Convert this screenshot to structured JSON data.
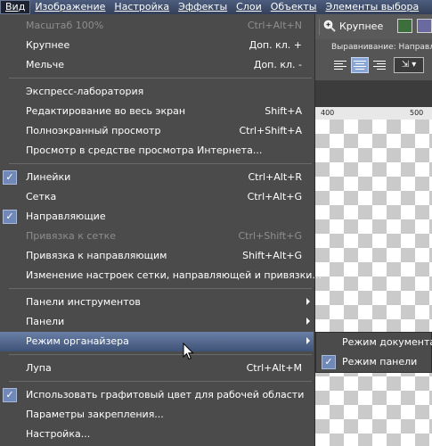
{
  "menubar": {
    "items": [
      {
        "label": "Вид"
      },
      {
        "label": "Изображение"
      },
      {
        "label": "Настройка"
      },
      {
        "label": "Эффекты"
      },
      {
        "label": "Слои"
      },
      {
        "label": "Объекты"
      },
      {
        "label": "Элементы выбора"
      }
    ]
  },
  "toolbar": {
    "zoom_in_label": "Крупнее",
    "zoom_icon": "magnifier-plus-icon",
    "alignment_label": "Выравнивание:  Направле"
  },
  "ruler": {
    "tick1": "400",
    "tick2": "500"
  },
  "view_menu": {
    "items": [
      {
        "label": "Масштаб 100%",
        "shortcut": "Ctrl+Alt+N",
        "disabled": true
      },
      {
        "label": "Крупнее",
        "shortcut": "Доп. кл. +"
      },
      {
        "label": "Мельче",
        "shortcut": "Доп. кл. -"
      },
      {
        "label": "Экспресс-лаборатория",
        "shortcut": ""
      },
      {
        "label": "Редактирование во весь экран",
        "shortcut": "Shift+A"
      },
      {
        "label": "Полноэкранный просмотр",
        "shortcut": "Ctrl+Shift+A"
      },
      {
        "label": "Просмотр в средстве просмотра Интернета...",
        "shortcut": ""
      },
      {
        "label": "Линейки",
        "shortcut": "Ctrl+Alt+R",
        "checked": true
      },
      {
        "label": "Сетка",
        "shortcut": "Ctrl+Alt+G"
      },
      {
        "label": "Направляющие",
        "shortcut": "",
        "checked": true
      },
      {
        "label": "Привязка к сетке",
        "shortcut": "Ctrl+Shift+G",
        "disabled": true
      },
      {
        "label": "Привязка к направляющим",
        "shortcut": "Shift+Alt+G"
      },
      {
        "label": "Изменение настроек сетки, направляющей и привязки...",
        "shortcut": ""
      },
      {
        "label": "Панели инструментов",
        "submenu": true
      },
      {
        "label": "Панели",
        "submenu": true
      },
      {
        "label": "Режим органайзера",
        "submenu": true,
        "highlighted": true
      },
      {
        "label": "Лупа",
        "shortcut": "Ctrl+Alt+M"
      },
      {
        "label": "Использовать графитовый цвет для рабочей области",
        "shortcut": "",
        "checked": true
      },
      {
        "label": "Параметры закрепления...",
        "shortcut": ""
      },
      {
        "label": "Настройка...",
        "shortcut": ""
      }
    ]
  },
  "organizer_submenu": {
    "items": [
      {
        "label": "Режим документа"
      },
      {
        "label": "Режим панели",
        "checked": true
      }
    ]
  },
  "colors": {
    "menu_bg": "#4b4b4b",
    "highlight": "#4f6590",
    "check_bg": "#7189b8"
  }
}
